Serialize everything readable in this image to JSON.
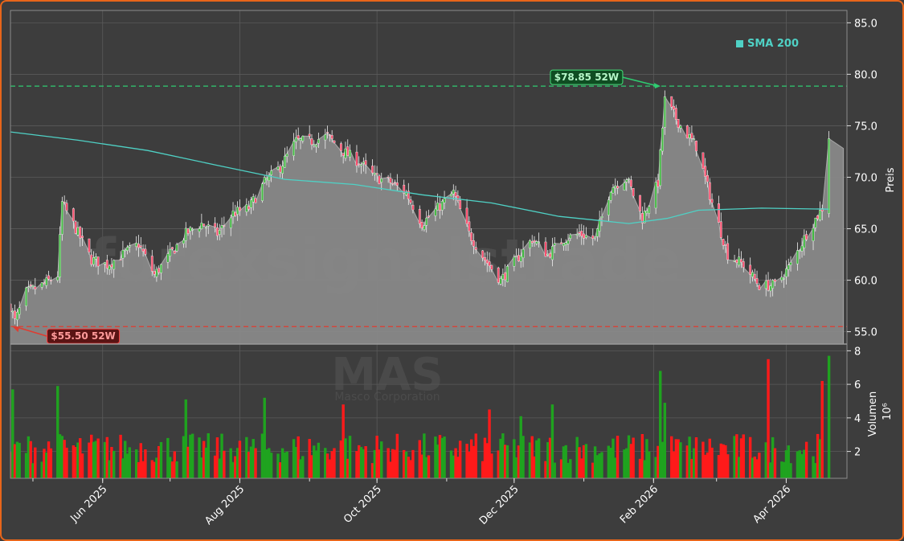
{
  "watermark": {
    "brand": "forexsignalstrade",
    "ticker": "MAS",
    "company": "Masco Corporation"
  },
  "chart_data": [
    {
      "type": "candlestick",
      "ylabel": "Preis",
      "ylim": [
        53.8,
        86.2
      ],
      "yticks": [
        55.0,
        60.0,
        65.0,
        70.0,
        75.0,
        80.0,
        85.0
      ],
      "ytick_labels": [
        "55.0",
        "60.0",
        "65.0",
        "70.0",
        "75.0",
        "80.0",
        "85.0"
      ],
      "xlim": [
        "2025-04-21",
        "2026-04-28"
      ],
      "xticks": [
        "2025-06-01",
        "2025-08-01",
        "2025-10-01",
        "2025-12-01",
        "2026-02-01",
        "2026-04-01"
      ],
      "xtick_labels": [
        "Jun 2025",
        "Aug 2025",
        "Oct 2025",
        "Dec 2025",
        "Feb 2026",
        "Apr 2026"
      ],
      "grid": true,
      "legend": {
        "position": "top-right",
        "entries": [
          {
            "name": "SMA 200",
            "color": "#4fd1c5"
          }
        ]
      },
      "colors": {
        "up": "#1fa31f",
        "down": "#ff1a1a",
        "sma": "#4fd1c5",
        "area": "#8a8a8a",
        "high_line": "#2ecc71",
        "low_line": "#e03c31"
      },
      "annotations": [
        {
          "label": "$78.85 52W",
          "date": "2026-02-03",
          "value": 78.85,
          "kind": "high"
        },
        {
          "label": "$55.50 52W",
          "date": "2025-04-23",
          "value": 55.5,
          "kind": "low"
        }
      ],
      "price_anchors": [
        [
          "2025-04-21",
          57.5
        ],
        [
          "2025-04-23",
          56.0
        ],
        [
          "2025-04-28",
          58.8
        ],
        [
          "2025-05-05",
          59.5
        ],
        [
          "2025-05-12",
          60.5
        ],
        [
          "2025-05-14",
          67.5
        ],
        [
          "2025-05-20",
          65.0
        ],
        [
          "2025-05-27",
          62.0
        ],
        [
          "2025-06-03",
          61.5
        ],
        [
          "2025-06-10",
          62.5
        ],
        [
          "2025-06-17",
          63.5
        ],
        [
          "2025-06-24",
          60.5
        ],
        [
          "2025-07-01",
          62.5
        ],
        [
          "2025-07-08",
          64.5
        ],
        [
          "2025-07-15",
          65.5
        ],
        [
          "2025-07-22",
          64.5
        ],
        [
          "2025-07-29",
          66.5
        ],
        [
          "2025-08-05",
          67.0
        ],
        [
          "2025-08-12",
          69.5
        ],
        [
          "2025-08-19",
          71.0
        ],
        [
          "2025-08-26",
          73.5
        ],
        [
          "2025-09-02",
          73.5
        ],
        [
          "2025-09-09",
          74.0
        ],
        [
          "2025-09-16",
          72.5
        ],
        [
          "2025-09-23",
          71.5
        ],
        [
          "2025-09-30",
          70.0
        ],
        [
          "2025-10-07",
          69.5
        ],
        [
          "2025-10-14",
          68.5
        ],
        [
          "2025-10-21",
          65.5
        ],
        [
          "2025-10-28",
          67.0
        ],
        [
          "2025-11-04",
          68.5
        ],
        [
          "2025-11-11",
          64.5
        ],
        [
          "2025-11-18",
          62.0
        ],
        [
          "2025-11-25",
          60.0
        ],
        [
          "2025-12-02",
          62.0
        ],
        [
          "2025-12-09",
          64.0
        ],
        [
          "2025-12-16",
          62.5
        ],
        [
          "2025-12-23",
          64.0
        ],
        [
          "2025-12-30",
          64.5
        ],
        [
          "2026-01-06",
          64.0
        ],
        [
          "2026-01-13",
          69.0
        ],
        [
          "2026-01-20",
          70.0
        ],
        [
          "2026-01-27",
          66.0
        ],
        [
          "2026-02-03",
          69.5
        ],
        [
          "2026-02-06",
          77.5
        ],
        [
          "2026-02-13",
          75.0
        ],
        [
          "2026-02-20",
          73.0
        ],
        [
          "2026-02-27",
          67.5
        ],
        [
          "2026-03-06",
          62.5
        ],
        [
          "2026-03-13",
          61.5
        ],
        [
          "2026-03-20",
          59.5
        ],
        [
          "2026-03-27",
          59.5
        ],
        [
          "2026-04-03",
          61.5
        ],
        [
          "2026-04-10",
          64.5
        ],
        [
          "2026-04-17",
          67.0
        ],
        [
          "2026-04-20",
          74.0
        ]
      ],
      "sma_200": [
        [
          "2025-04-21",
          74.4
        ],
        [
          "2025-05-21",
          73.6
        ],
        [
          "2025-06-21",
          72.6
        ],
        [
          "2025-07-21",
          71.2
        ],
        [
          "2025-08-21",
          69.8
        ],
        [
          "2025-09-21",
          69.3
        ],
        [
          "2025-10-21",
          68.3
        ],
        [
          "2025-11-21",
          67.5
        ],
        [
          "2025-12-21",
          66.2
        ],
        [
          "2026-01-21",
          65.5
        ],
        [
          "2026-02-07",
          66.0
        ],
        [
          "2026-02-21",
          66.8
        ],
        [
          "2026-03-21",
          67.0
        ],
        [
          "2026-04-20",
          66.9
        ]
      ]
    },
    {
      "type": "bar",
      "ylabel": "Volumen",
      "y_scale_label": "10⁶",
      "ylim": [
        0.4,
        8.4
      ],
      "yticks": [
        2,
        4,
        6,
        8
      ],
      "ytick_labels": [
        "2",
        "4",
        "6",
        "8"
      ],
      "colors": {
        "up": "#1fa31f",
        "down": "#ff1a1a"
      },
      "volume_spikes": [
        [
          "2025-04-22",
          5.7
        ],
        [
          "2025-05-12",
          5.9
        ],
        [
          "2025-07-08",
          5.1
        ],
        [
          "2025-08-12",
          5.2
        ],
        [
          "2025-09-16",
          4.8
        ],
        [
          "2025-11-20",
          4.5
        ],
        [
          "2025-12-04",
          4.1
        ],
        [
          "2025-12-18",
          4.8
        ],
        [
          "2026-02-04",
          6.8
        ],
        [
          "2026-02-06",
          4.9
        ],
        [
          "2026-03-24",
          7.5
        ],
        [
          "2026-04-17",
          6.2
        ],
        [
          "2026-04-20",
          7.7
        ]
      ]
    }
  ]
}
